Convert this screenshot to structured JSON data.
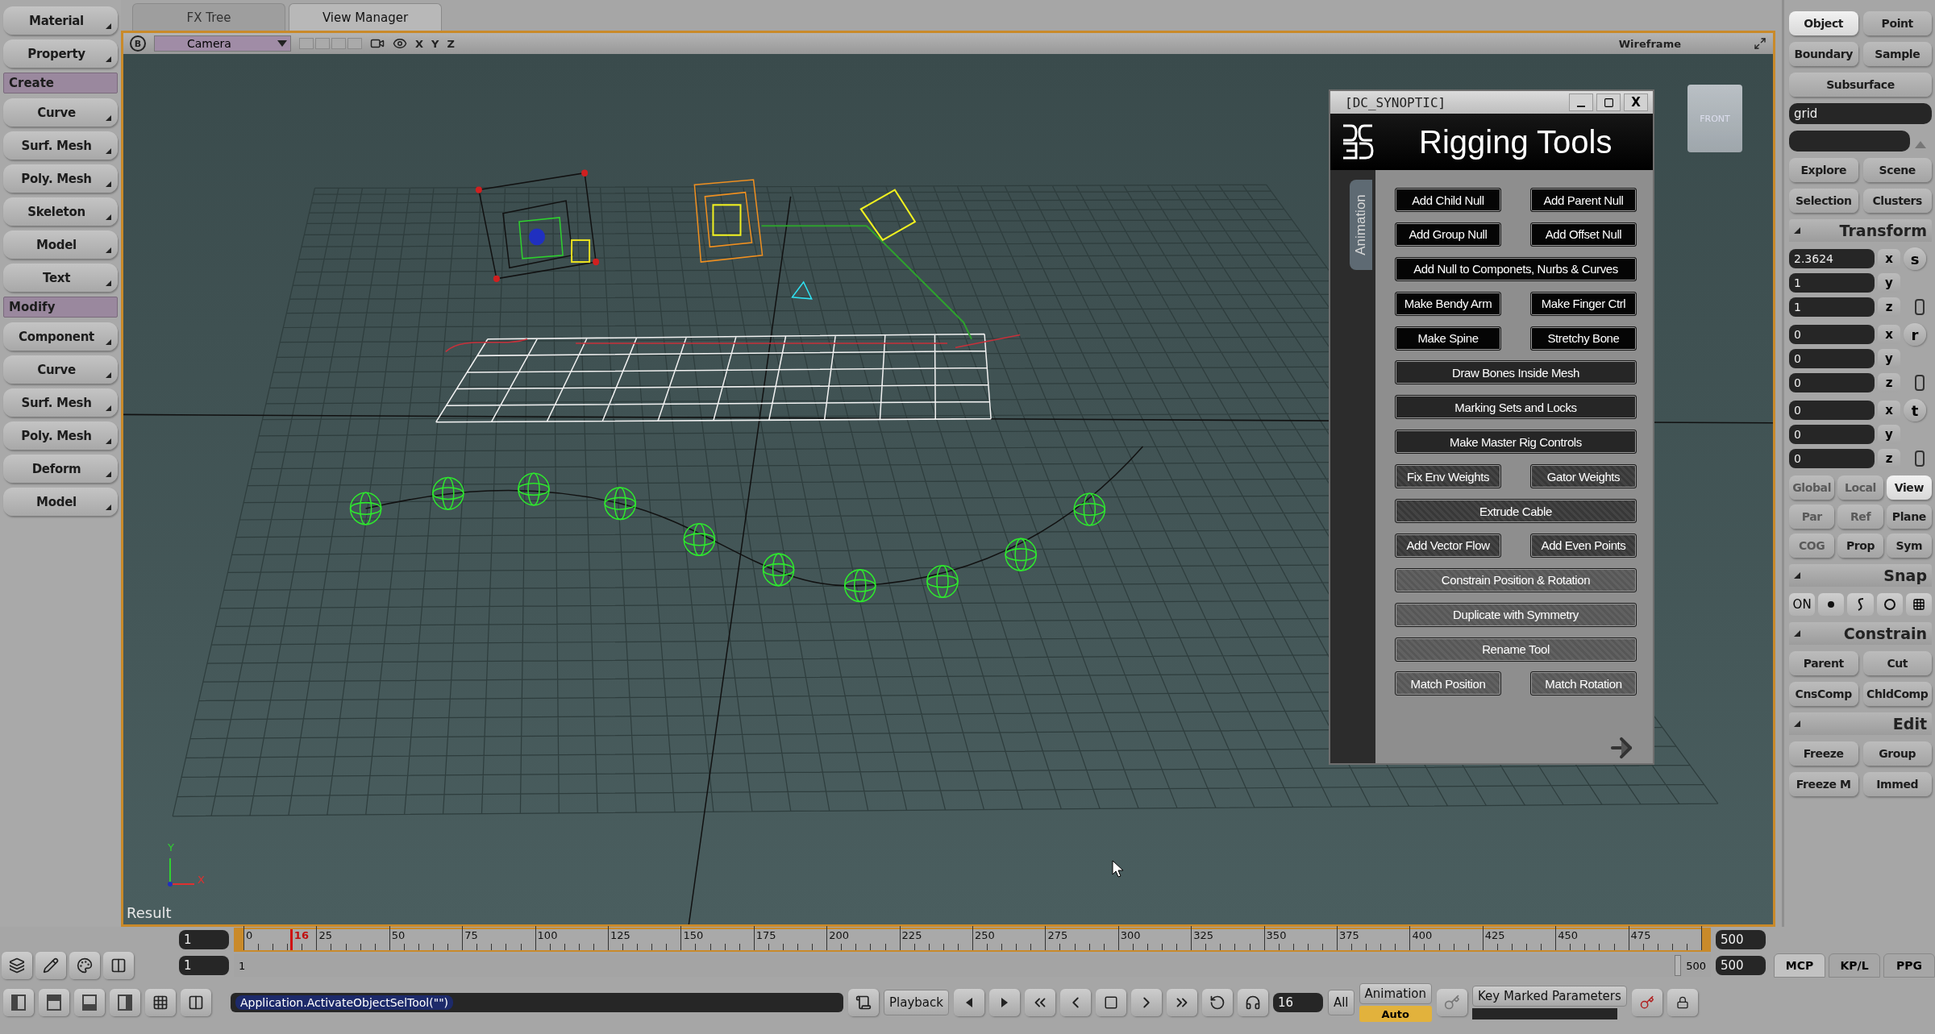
{
  "left_panel": {
    "items": [
      {
        "kind": "button",
        "label": "Material"
      },
      {
        "kind": "button",
        "label": "Property"
      },
      {
        "kind": "header",
        "label": "Create"
      },
      {
        "kind": "button",
        "label": "Curve"
      },
      {
        "kind": "button",
        "label": "Surf. Mesh"
      },
      {
        "kind": "button",
        "label": "Poly. Mesh"
      },
      {
        "kind": "button",
        "label": "Skeleton"
      },
      {
        "kind": "button",
        "label": "Model"
      },
      {
        "kind": "button",
        "label": "Text"
      },
      {
        "kind": "header",
        "label": "Modify"
      },
      {
        "kind": "button",
        "label": "Component"
      },
      {
        "kind": "button",
        "label": "Curve"
      },
      {
        "kind": "button",
        "label": "Surf. Mesh"
      },
      {
        "kind": "button",
        "label": "Poly. Mesh"
      },
      {
        "kind": "button",
        "label": "Deform"
      },
      {
        "kind": "button",
        "label": "Model"
      }
    ]
  },
  "viewport_tabs": [
    {
      "label": "FX Tree",
      "selected": false
    },
    {
      "label": "View Manager",
      "selected": true
    }
  ],
  "viewport": {
    "badge": "B",
    "camera": "Camera",
    "axes": [
      "X",
      "Y",
      "Z"
    ],
    "mode": "Wireframe",
    "view_cube": "FRONT",
    "result": "Result",
    "axis_labels": [
      "Y",
      "X"
    ]
  },
  "synoptic": {
    "title": "[DC_SYNOPTIC]",
    "close": "X",
    "heading": "Rigging Tools",
    "side_tab": "Animation",
    "rows": [
      {
        "kind": "black",
        "buttons": [
          "Add Child Null",
          "Add Parent Null"
        ]
      },
      {
        "kind": "black",
        "buttons": [
          "Add Group Null",
          "Add Offset Null"
        ]
      },
      {
        "kind": "black",
        "buttons": [
          "Add Null to Componets, Nurbs & Curves"
        ]
      },
      {
        "kind": "black",
        "buttons": [
          "Make Bendy Arm",
          "Make Finger Ctrl"
        ]
      },
      {
        "kind": "black",
        "buttons": [
          "Make Spine",
          "Stretchy Bone"
        ]
      },
      {
        "kind": "dark",
        "buttons": [
          "Draw Bones Inside Mesh"
        ]
      },
      {
        "kind": "dark",
        "buttons": [
          "Marking Sets and Locks"
        ]
      },
      {
        "kind": "dark",
        "buttons": [
          "Make Master Rig Controls"
        ]
      },
      {
        "kind": "mid",
        "buttons": [
          "Fix Env Weights",
          "Gator Weights"
        ]
      },
      {
        "kind": "mid",
        "buttons": [
          "Extrude Cable"
        ]
      },
      {
        "kind": "mid",
        "buttons": [
          "Add Vector Flow",
          "Add Even Points"
        ]
      },
      {
        "kind": "light",
        "buttons": [
          "Constrain Position & Rotation"
        ]
      },
      {
        "kind": "light",
        "buttons": [
          "Duplicate with Symmetry"
        ]
      },
      {
        "kind": "light",
        "buttons": [
          "Rename Tool"
        ]
      },
      {
        "kind": "light",
        "buttons": [
          "Match Position",
          "Match Rotation"
        ]
      }
    ]
  },
  "right_panel": {
    "selection_filters": [
      {
        "label": "Object",
        "selected": true
      },
      {
        "label": "Point",
        "selected": false
      },
      {
        "label": "Boundary",
        "selected": false
      },
      {
        "label": "Sample",
        "selected": false
      }
    ],
    "subsurface": "Subsurface",
    "name_field": "grid",
    "explore_buttons": [
      "Explore",
      "Scene",
      "Selection",
      "Clusters"
    ],
    "transform": {
      "title": "Transform",
      "groups": [
        {
          "label": "s",
          "fields": [
            {
              "axis": "x",
              "value": "2.3624"
            },
            {
              "axis": "y",
              "value": "1"
            },
            {
              "axis": "z",
              "value": "1"
            }
          ]
        },
        {
          "label": "r",
          "fields": [
            {
              "axis": "x",
              "value": "0"
            },
            {
              "axis": "y",
              "value": "0"
            },
            {
              "axis": "z",
              "value": "0"
            }
          ]
        },
        {
          "label": "t",
          "fields": [
            {
              "axis": "x",
              "value": "0"
            },
            {
              "axis": "y",
              "value": "0"
            },
            {
              "axis": "z",
              "value": "0"
            }
          ]
        }
      ],
      "modes": [
        {
          "label": "Global",
          "disabled": true,
          "selected": false
        },
        {
          "label": "Local",
          "disabled": true,
          "selected": false
        },
        {
          "label": "View",
          "disabled": false,
          "selected": true
        },
        {
          "label": "Par",
          "disabled": true,
          "selected": false
        },
        {
          "label": "Ref",
          "disabled": true,
          "selected": false
        },
        {
          "label": "Plane",
          "disabled": false,
          "selected": false
        },
        {
          "label": "COG",
          "disabled": true,
          "selected": false
        },
        {
          "label": "Prop",
          "disabled": false,
          "selected": false
        },
        {
          "label": "Sym",
          "disabled": false,
          "selected": false
        }
      ]
    },
    "snap": {
      "title": "Snap",
      "on_label": "ON"
    },
    "constrain": {
      "title": "Constrain",
      "buttons": [
        "Parent",
        "Cut",
        "CnsComp",
        "ChldComp"
      ]
    },
    "edit": {
      "title": "Edit",
      "buttons": [
        "Freeze",
        "Group",
        "Freeze M",
        "Immed"
      ]
    }
  },
  "timeline": {
    "start": "1",
    "end": "500",
    "labels": [
      "0",
      "25",
      "50",
      "75",
      "100",
      "125",
      "150",
      "175",
      "200",
      "225",
      "250",
      "275",
      "300",
      "325",
      "350",
      "375",
      "400",
      "425",
      "450",
      "475"
    ],
    "current_frame": "16",
    "range_start": "1",
    "range_bar": {
      "level": 1,
      "start_label": "1",
      "end_label": "500"
    },
    "range_end": "500"
  },
  "panel_tabs": [
    {
      "label": "MCP",
      "selected": true
    },
    {
      "label": "KP/L",
      "selected": false
    },
    {
      "label": "PPG",
      "selected": false
    }
  ],
  "bottom_bar": {
    "script": "Application.ActivateObjectSelTool(\"\")",
    "playback": "Playback",
    "frame": "16",
    "all": "All",
    "animation": "Animation",
    "auto": "Auto",
    "key_marked": "Key Marked Parameters"
  }
}
